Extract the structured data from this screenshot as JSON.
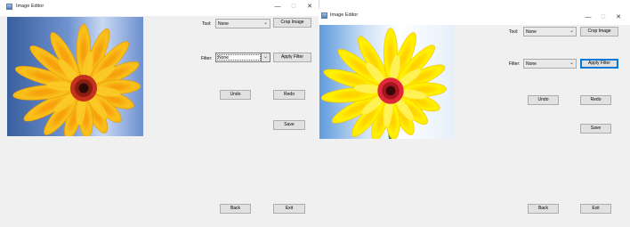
{
  "windows": [
    {
      "title": "Image Editor",
      "tool_label": "Tool:",
      "tool_value": "None",
      "filter_label": "Filter:",
      "filter_value": "None",
      "crop_button": "Crop Image",
      "apply_filter_button": "Apply Filter",
      "undo_button": "Undo",
      "redo_button": "Redo",
      "save_button": "Save",
      "back_button": "Back",
      "exit_button": "Exit",
      "minimize_glyph": "—",
      "maximize_glyph": "☐",
      "close_glyph": "✕",
      "photo": "gerbera-flower-original"
    },
    {
      "title": "Image Editor",
      "tool_label": "Tool:",
      "tool_value": "None",
      "filter_label": "Filter:",
      "filter_value": "None",
      "crop_button": "Crop Image",
      "apply_filter_button": "Apply Filter",
      "undo_button": "Undo",
      "redo_button": "Redo",
      "save_button": "Save",
      "back_button": "Back",
      "exit_button": "Exit",
      "minimize_glyph": "—",
      "maximize_glyph": "☐",
      "close_glyph": "✕",
      "photo": "gerbera-flower-filtered"
    }
  ],
  "colors": {
    "window_bg": "#f0f0f0",
    "button_bg": "#e1e1e1",
    "focus_border": "#0078d7"
  }
}
